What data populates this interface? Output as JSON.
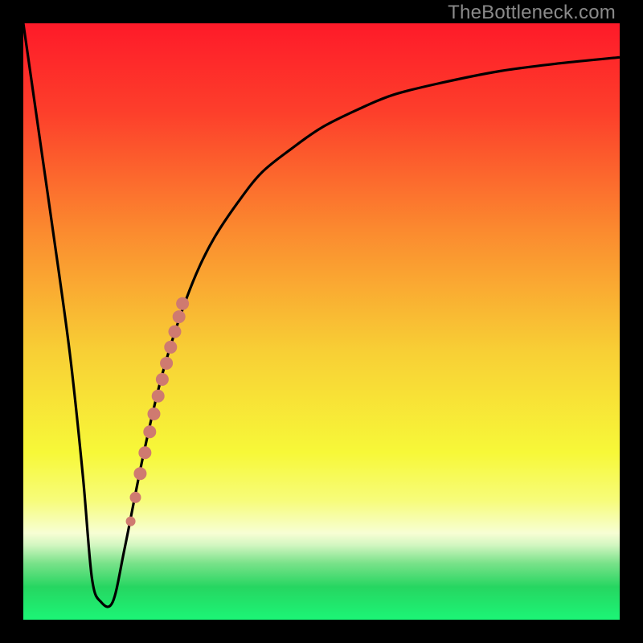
{
  "watermark": "TheBottleneck.com",
  "colors": {
    "background": "#000000",
    "curve": "#000000",
    "dot": "#cf7a70",
    "gradient_stops": [
      {
        "offset": 0.0,
        "color": "#fe1a29"
      },
      {
        "offset": 0.15,
        "color": "#fd3f2b"
      },
      {
        "offset": 0.35,
        "color": "#fb8b2f"
      },
      {
        "offset": 0.55,
        "color": "#f8cf35"
      },
      {
        "offset": 0.72,
        "color": "#f7f838"
      },
      {
        "offset": 0.8,
        "color": "#f7fc7a"
      },
      {
        "offset": 0.855,
        "color": "#f7fed4"
      },
      {
        "offset": 0.875,
        "color": "#d2f6c0"
      },
      {
        "offset": 0.905,
        "color": "#7ae28a"
      },
      {
        "offset": 0.945,
        "color": "#26d661"
      },
      {
        "offset": 1.0,
        "color": "#1cf576"
      }
    ]
  },
  "chart_data": {
    "type": "line",
    "title": "",
    "xlabel": "",
    "ylabel": "",
    "xlim": [
      0,
      100
    ],
    "ylim": [
      0,
      100
    ],
    "curve": {
      "name": "bottleneck-curve",
      "x": [
        0,
        3,
        6,
        8,
        10,
        11.5,
        13,
        15,
        17,
        20,
        23,
        26,
        29,
        32,
        36,
        40,
        45,
        50,
        56,
        62,
        70,
        80,
        90,
        100
      ],
      "y": [
        100,
        79,
        58,
        43,
        24,
        7,
        3,
        3,
        12,
        27,
        40,
        50,
        58,
        64,
        70,
        75,
        79,
        82.5,
        85.5,
        88,
        90,
        92,
        93.3,
        94.3
      ]
    },
    "series": [
      {
        "name": "dots",
        "x": [
          18.0,
          18.8,
          19.6,
          20.4,
          21.2,
          21.9,
          22.6,
          23.3,
          24.0,
          24.7,
          25.4,
          26.1,
          26.7
        ],
        "y": [
          16.5,
          20.5,
          24.5,
          28.0,
          31.5,
          34.5,
          37.5,
          40.3,
          43.0,
          45.7,
          48.3,
          50.8,
          53.0
        ],
        "r": [
          6,
          7,
          8,
          8,
          8,
          8,
          8,
          8,
          8,
          8,
          8,
          8,
          8
        ]
      }
    ]
  }
}
